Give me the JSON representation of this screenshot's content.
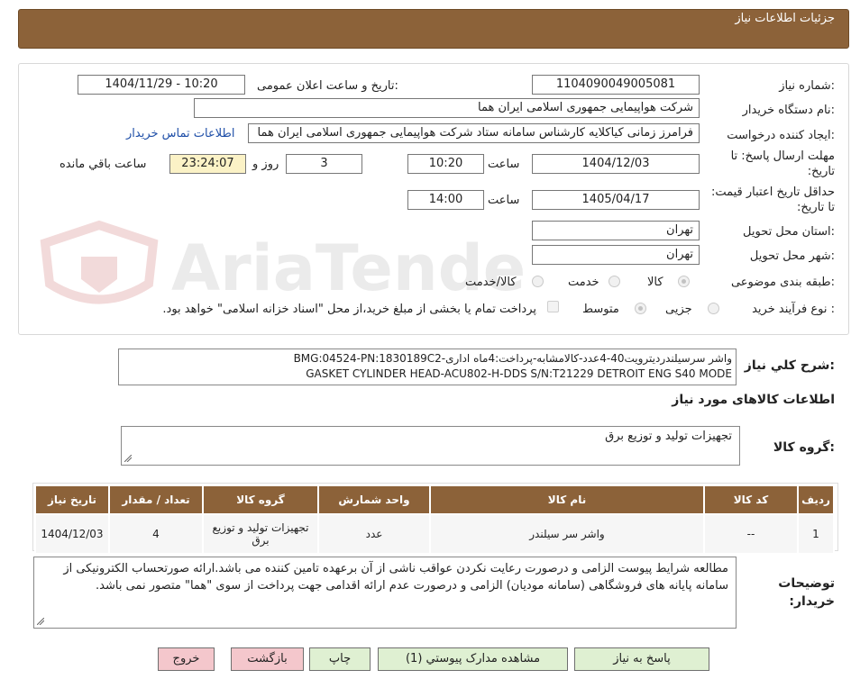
{
  "header": {
    "title": "جزئیات اطلاعات نیاز"
  },
  "form": {
    "need_number": {
      "label": "شماره نیاز:",
      "value": "1104090049005081"
    },
    "announce": {
      "label": "تاریخ و ساعت اعلان عمومی:",
      "value": "1404/11/29 - 10:20"
    },
    "buyer_org": {
      "label": "نام دستگاه خریدار:",
      "value": "شرکت هواپیمایی جمهوری اسلامی ایران هما"
    },
    "creator": {
      "label": "ایجاد کننده درخواست:",
      "value": "فرامرز زمانی کیاکلایه کارشناس سامانه ستاد شرکت هواپیمایی جمهوری اسلامی ایران هما",
      "contact_link": "اطلاعات تماس خریدار"
    },
    "deadline": {
      "label": "مهلت ارسال پاسخ: تا تاریخ:",
      "date": "1404/12/03",
      "time_label": "ساعت",
      "time": "10:20",
      "days": "3",
      "days_label": "روز و",
      "remaining": "23:24:07",
      "remaining_label": "ساعت باقي مانده"
    },
    "validity": {
      "label": "حداقل تاریخ اعتبار قیمت: تا تاریخ:",
      "date": "1405/04/17",
      "time_label": "ساعت",
      "time": "14:00"
    },
    "province": {
      "label": "استان محل تحویل:",
      "value": "تهران"
    },
    "city": {
      "label": "شهر محل تحویل:",
      "value": "تهران"
    },
    "category": {
      "label": "طبقه بندی موضوعی:",
      "options": [
        "کالا",
        "خدمت",
        "کالا/خدمت"
      ]
    },
    "process": {
      "label": "نوع فرآیند خرید :",
      "options": [
        "جزیی",
        "متوسط"
      ],
      "payment_note": "پرداخت تمام یا بخشی از مبلغ خرید،از محل \"اسناد خزانه اسلامی\" خواهد بود."
    }
  },
  "watermark": {
    "text": "AriaTender.neT"
  },
  "description": {
    "label": "شرح کلي نیاز:",
    "line1": "واشر سرسیلندردیترویت40-4عدد-کالامشابه-پرداخت:4ماه اداری-BMG:04524-PN:1830189C2",
    "line2": "GASKET CYLINDER HEAD-ACU802-H-DDS S/N:T21229 DETROIT ENG S40 MODE"
  },
  "goods_info": {
    "title": "اطلاعات کالاهای مورد نیاز",
    "group_label": "گروه کالا:",
    "group_value": "تجهیزات تولید و توزیع برق"
  },
  "table": {
    "headers": [
      "ردیف",
      "کد کالا",
      "نام کالا",
      "واحد شمارش",
      "گروه کالا",
      "تعداد / مقدار",
      "تاریخ نیاز"
    ],
    "rows": [
      [
        "1",
        "--",
        "واشر سر سیلندر",
        "عدد",
        "تجهیزات تولید و توزیع برق",
        "4",
        "1404/12/03"
      ]
    ]
  },
  "buyer_notes": {
    "label": "توضیحات خریدار:",
    "text": "مطالعه شرایط پیوست الزامی و درصورت رعایت نکردن عواقب ناشی از آن برعهده تامین کننده می باشد.ارائه صورتحساب الکترونیکی از سامانه پایانه های فروشگاهی (سامانه مودیان) الزامی و درصورت عدم ارائه اقدامی جهت پرداخت از سوی \"هما\" متصور نمی باشد."
  },
  "buttons": {
    "respond": "پاسخ به نیاز",
    "attachments": "مشاهده مدارک پیوستي (1)",
    "print": "چاپ",
    "back": "بازگشت",
    "exit": "خروج"
  }
}
